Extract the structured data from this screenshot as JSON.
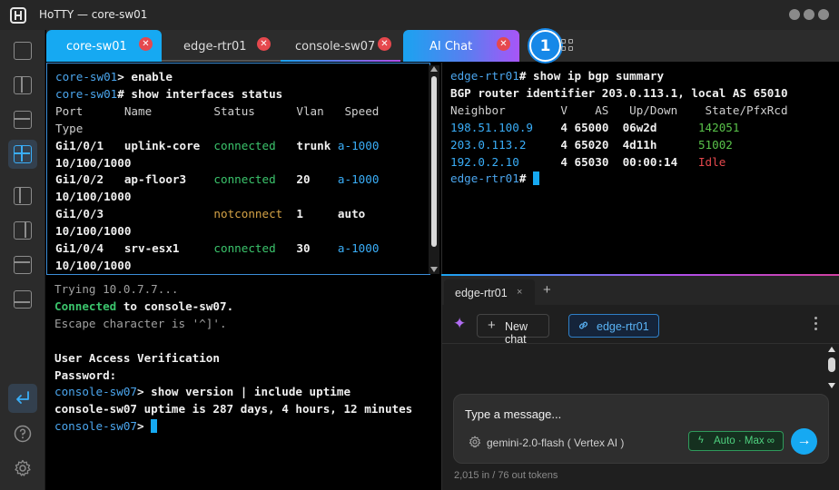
{
  "window": {
    "title": "HoTTY — core-sw01"
  },
  "tabs": [
    {
      "label": "core-sw01",
      "active": true
    },
    {
      "label": "edge-rtr01",
      "active": false
    },
    {
      "label": "console-sw07",
      "active": false
    },
    {
      "label": "AI Chat",
      "active": false
    }
  ],
  "tab_close_glyph": "✕",
  "badge": "1",
  "pane_core": {
    "prompt": "core-sw01",
    "cmd1": "enable",
    "cmd2": "show interfaces status",
    "header": "Port      Name         Status      Vlan   Speed",
    "header2": "Type",
    "rows": [
      {
        "port": "Gi1/0/1   ",
        "name": "uplink-core  ",
        "status": "connected",
        "vlan": "trunk ",
        "speed": "a-1000",
        "type": "10/100/1000"
      },
      {
        "port": "Gi1/0/2   ",
        "name": "ap-floor3    ",
        "status": "connected",
        "vlan": "20    ",
        "speed": "a-1000",
        "type": "10/100/1000"
      },
      {
        "port": "Gi1/0/3   ",
        "name": "             ",
        "status": "notconnect",
        "vlan": "1     ",
        "speed": "auto",
        "type": "10/100/1000"
      },
      {
        "port": "Gi1/0/4   ",
        "name": "srv-esx1     ",
        "status": "connected",
        "vlan": "30    ",
        "speed": "a-1000",
        "type": "10/100/1000"
      }
    ]
  },
  "pane_edge": {
    "prompt": "edge-rtr01",
    "cmd": "show ip bgp summary",
    "line1": "BGP router identifier 203.0.113.1, local AS 65010",
    "header": "Neighbor        V    AS   Up/Down    State/PfxRcd",
    "rows": [
      {
        "neighbor": "198.51.100.9 ",
        "rest": "   4 65000  06w2d      ",
        "state": "142051",
        "color": "#59c24a"
      },
      {
        "neighbor": "203.0.113.2  ",
        "rest": "   4 65020  4d11h      ",
        "state": "51002",
        "color": "#59c24a"
      },
      {
        "neighbor": "192.0.2.10   ",
        "rest": "   4 65030  00:00:14   ",
        "state": "Idle",
        "color": "#e5484d"
      }
    ]
  },
  "pane_console": {
    "trying": "Trying 10.0.7.7...",
    "connected": "Connected",
    "connected_rest": " to console-sw07.",
    "escape": "Escape character is '^]'.",
    "uav": "User Access Verification",
    "password": "Password:",
    "prompt": "console-sw07",
    "cmd": "show version | include uptime",
    "uptime": "console-sw07 uptime is 287 days, 4 hours, 12 minutes"
  },
  "chat": {
    "tab_label": "edge-rtr01",
    "tab_close": "×",
    "add_tab": "+",
    "new_chat": "New chat",
    "context_chip": "edge-rtr01",
    "placeholder": "Type a message...",
    "model": "gemini-2.0-flash  ( Vertex AI )",
    "auto_chip": "Auto · Max ∞",
    "send": "→",
    "tokens": "2,015 in / 76 out tokens"
  },
  "colors": {
    "accent": "#16a9f2",
    "close": "#e5484d",
    "ok": "#3bc46c",
    "warn": "#d4a246"
  },
  "sidebar_icons": [
    "layout-single-icon",
    "layout-split-vertical-icon",
    "layout-split-horizontal-icon",
    "layout-quad-icon",
    "layout-left-main-icon",
    "layout-right-main-icon",
    "layout-top-main-icon",
    "layout-bottom-main-icon",
    "return-icon",
    "help-icon",
    "settings-icon"
  ]
}
